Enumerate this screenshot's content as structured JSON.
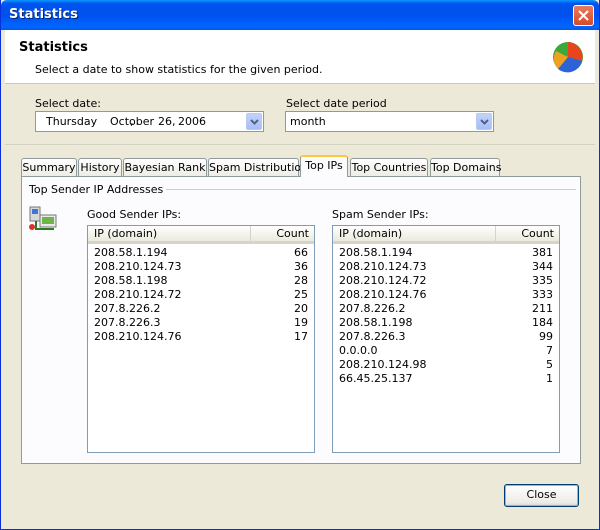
{
  "window": {
    "title": "Statistics"
  },
  "header": {
    "title": "Statistics",
    "subtitle": "Select a date to show statistics for the given period."
  },
  "date_select": {
    "label": "Select date:",
    "weekday": "Thursday",
    "comma": ",",
    "month": "October",
    "day": "26,",
    "year": "2006"
  },
  "period_select": {
    "label": "Select date period",
    "value": "month"
  },
  "tabs": [
    {
      "label": "Summary",
      "active": false
    },
    {
      "label": "History",
      "active": false
    },
    {
      "label": "Bayesian Rank",
      "active": false
    },
    {
      "label": "Spam Distribution",
      "active": false
    },
    {
      "label": "Top IPs",
      "active": true
    },
    {
      "label": "Top Countries",
      "active": false
    },
    {
      "label": "Top Domains",
      "active": false
    }
  ],
  "top_ips": {
    "group_title": "Top Sender IP Addresses",
    "good": {
      "label": "Good Sender IPs:",
      "columns": [
        "IP (domain)",
        "Count"
      ],
      "rows": [
        {
          "ip": "208.58.1.194",
          "count": "66"
        },
        {
          "ip": "208.210.124.73",
          "count": "36"
        },
        {
          "ip": "208.58.1.198",
          "count": "28"
        },
        {
          "ip": "208.210.124.72",
          "count": "25"
        },
        {
          "ip": "207.8.226.2",
          "count": "20"
        },
        {
          "ip": "207.8.226.3",
          "count": "19"
        },
        {
          "ip": "208.210.124.76",
          "count": "17"
        }
      ]
    },
    "spam": {
      "label": "Spam Sender IPs:",
      "columns": [
        "IP (domain)",
        "Count"
      ],
      "rows": [
        {
          "ip": "208.58.1.194",
          "count": "381"
        },
        {
          "ip": "208.210.124.73",
          "count": "344"
        },
        {
          "ip": "208.210.124.72",
          "count": "335"
        },
        {
          "ip": "208.210.124.76",
          "count": "333"
        },
        {
          "ip": "207.8.226.2",
          "count": "211"
        },
        {
          "ip": "208.58.1.198",
          "count": "184"
        },
        {
          "ip": "207.8.226.3",
          "count": "99"
        },
        {
          "ip": "0.0.0.0",
          "count": "7"
        },
        {
          "ip": "208.210.124.98",
          "count": "5"
        },
        {
          "ip": "66.45.25.137",
          "count": "1"
        }
      ]
    }
  },
  "footer": {
    "close_label": "Close"
  },
  "colors": {
    "titlebar": "#0054e3",
    "window_bg": "#ece9d8",
    "active_tab_accent": "#ffc83c"
  }
}
